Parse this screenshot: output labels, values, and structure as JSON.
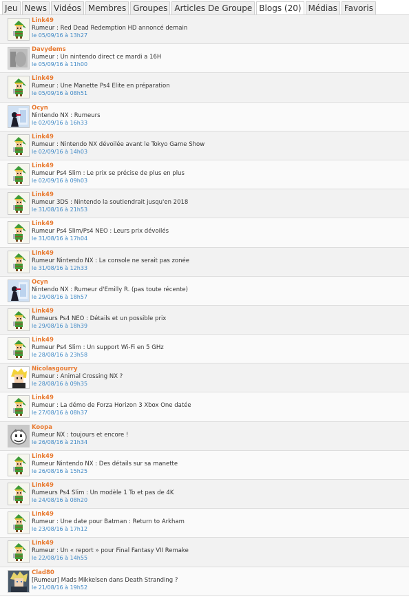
{
  "tabs": [
    {
      "label": "Jeu"
    },
    {
      "label": "News"
    },
    {
      "label": "Vidéos"
    },
    {
      "label": "Membres"
    },
    {
      "label": "Groupes"
    },
    {
      "label": "Articles De Groupe"
    },
    {
      "label": "Blogs (20)"
    },
    {
      "label": "Médias"
    },
    {
      "label": "Favoris"
    }
  ],
  "articles": [
    {
      "author": "Link49",
      "avatar": "link-avatar",
      "title": "Rumeur : Red Dead Redemption HD annoncé demain",
      "date": "le 05/09/16 à 13h27"
    },
    {
      "author": "Davydems",
      "avatar": "davydems-avatar",
      "title": "Rumeur : Un nintendo direct ce mardi a 16H",
      "date": "le 05/09/16 à 11h00"
    },
    {
      "author": "Link49",
      "avatar": "link-avatar",
      "title": "Rumeur : Une Manette Ps4 Elite en préparation",
      "date": "le 05/09/16 à 08h51"
    },
    {
      "author": "Ocyn",
      "avatar": "ocyn-avatar",
      "title": "Nintendo NX : Rumeurs",
      "date": "le 02/09/16 à 16h33"
    },
    {
      "author": "Link49",
      "avatar": "link-avatar",
      "title": "Rumeur : Nintendo NX dévoilée avant le Tokyo Game Show",
      "date": "le 02/09/16 à 14h03"
    },
    {
      "author": "Link49",
      "avatar": "link-avatar",
      "title": "Rumeur Ps4 Slim : Le prix se précise de plus en plus",
      "date": "le 02/09/16 à 09h03"
    },
    {
      "author": "Link49",
      "avatar": "link-avatar",
      "title": "Rumeur 3DS : Nintendo la soutiendrait jusqu'en 2018",
      "date": "le 31/08/16 à 21h53"
    },
    {
      "author": "Link49",
      "avatar": "link-avatar",
      "title": "Rumeur Ps4 Slim/Ps4 NEO : Leurs prix dévoilés",
      "date": "le 31/08/16 à 17h04"
    },
    {
      "author": "Link49",
      "avatar": "link-avatar",
      "title": "Rumeur Nintendo NX : La console ne serait pas zonée",
      "date": "le 31/08/16 à 12h33"
    },
    {
      "author": "Ocyn",
      "avatar": "ocyn-avatar",
      "title": "Nintendo NX : Rumeur d'Emilly R. (pas toute récente)",
      "date": "le 29/08/16 à 18h57"
    },
    {
      "author": "Link49",
      "avatar": "link-avatar",
      "title": "Rumeurs Ps4 NEO : Détails et un possible prix",
      "date": "le 29/08/16 à 18h39"
    },
    {
      "author": "Link49",
      "avatar": "link-avatar",
      "title": "Rumeur Ps4 Slim : Un support Wi-Fi en 5 GHz",
      "date": "le 28/08/16 à 23h58"
    },
    {
      "author": "Nicolasgourry",
      "avatar": "nicolasgourry-avatar",
      "title": "Rumeur : Animal Crossing NX ?",
      "date": "le 28/08/16 à 09h35"
    },
    {
      "author": "Link49",
      "avatar": "link-avatar",
      "title": "Rumeur : La démo de Forza Horizon 3 Xbox One datée",
      "date": "le 27/08/16 à 08h37"
    },
    {
      "author": "Koopa",
      "avatar": "koopa-avatar",
      "title": "Rumeur NX : toujours et encore !",
      "date": "le 26/08/16 à 21h34"
    },
    {
      "author": "Link49",
      "avatar": "link-avatar",
      "title": "Rumeur Nintendo NX : Des détails sur sa manette",
      "date": "le 26/08/16 à 15h25"
    },
    {
      "author": "Link49",
      "avatar": "link-avatar",
      "title": "Rumeurs Ps4 Slim : Un modèle 1 To et pas de 4K",
      "date": "le 24/08/16 à 08h20"
    },
    {
      "author": "Link49",
      "avatar": "link-avatar",
      "title": "Rumeur : Une date pour Batman : Return to Arkham",
      "date": "le 23/08/16 à 17h12"
    },
    {
      "author": "Link49",
      "avatar": "link-avatar",
      "title": "Rumeur : Un « report » pour Final Fantasy VII Remake",
      "date": "le 22/08/16 à 14h55"
    },
    {
      "author": "Clad80",
      "avatar": "clad80-avatar",
      "title": "[Rumeur] Mads Mikkelsen dans Death Stranding ?",
      "date": "le 21/08/16 à 19h52"
    }
  ]
}
